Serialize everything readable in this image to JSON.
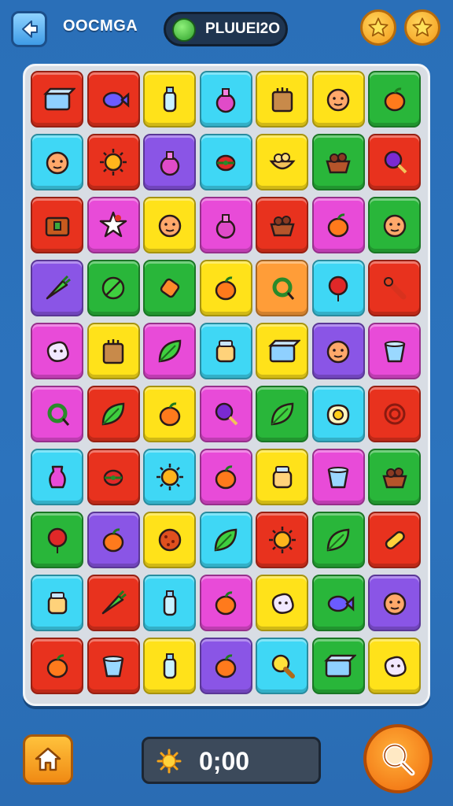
{
  "header": {
    "title": "OOCMGA",
    "level_label": "PLUUEI2O",
    "back_icon": "back-arrow-icon",
    "star_icons": [
      "star-icon",
      "star-icon"
    ]
  },
  "board": {
    "rows": 10,
    "cols": 7,
    "tiles": [
      [
        "red",
        "box"
      ],
      [
        "red",
        "fish"
      ],
      [
        "yellow",
        "bottle"
      ],
      [
        "cyan",
        "potion"
      ],
      [
        "yellow",
        "bag"
      ],
      [
        "yellow",
        "face"
      ],
      [
        "green",
        "fruit"
      ],
      [
        "cyan",
        "face"
      ],
      [
        "red",
        "sun"
      ],
      [
        "purple",
        "potion"
      ],
      [
        "cyan",
        "bug"
      ],
      [
        "yellow",
        "bowl"
      ],
      [
        "green",
        "basket"
      ],
      [
        "red",
        "lollipop"
      ],
      [
        "red",
        "chest"
      ],
      [
        "pink",
        "star"
      ],
      [
        "yellow",
        "face"
      ],
      [
        "pink",
        "potion"
      ],
      [
        "red",
        "basket"
      ],
      [
        "pink",
        "fruit"
      ],
      [
        "green",
        "face"
      ],
      [
        "purple",
        "carrot"
      ],
      [
        "green",
        "circle"
      ],
      [
        "green",
        "candy"
      ],
      [
        "yellow",
        "fruit"
      ],
      [
        "orange",
        "ring"
      ],
      [
        "cyan",
        "balloon"
      ],
      [
        "red",
        "pin"
      ],
      [
        "pink",
        "blob"
      ],
      [
        "yellow",
        "bag"
      ],
      [
        "pink",
        "leaf"
      ],
      [
        "cyan",
        "jar"
      ],
      [
        "yellow",
        "box"
      ],
      [
        "purple",
        "face"
      ],
      [
        "pink",
        "cup"
      ],
      [
        "pink",
        "ring"
      ],
      [
        "red",
        "leaf"
      ],
      [
        "yellow",
        "fruit"
      ],
      [
        "pink",
        "lollipop"
      ],
      [
        "green",
        "leaf"
      ],
      [
        "cyan",
        "egg"
      ],
      [
        "red",
        "swirl"
      ],
      [
        "cyan",
        "vase"
      ],
      [
        "red",
        "bug"
      ],
      [
        "cyan",
        "sun"
      ],
      [
        "pink",
        "fruit"
      ],
      [
        "yellow",
        "jar"
      ],
      [
        "pink",
        "cup"
      ],
      [
        "green",
        "basket"
      ],
      [
        "green",
        "balloon"
      ],
      [
        "purple",
        "fruit"
      ],
      [
        "yellow",
        "ball"
      ],
      [
        "cyan",
        "leaf"
      ],
      [
        "red",
        "sun"
      ],
      [
        "green",
        "leaf"
      ],
      [
        "red",
        "pill"
      ],
      [
        "cyan",
        "jar"
      ],
      [
        "red",
        "carrot"
      ],
      [
        "cyan",
        "bottle"
      ],
      [
        "pink",
        "fruit"
      ],
      [
        "yellow",
        "blob"
      ],
      [
        "green",
        "fish"
      ],
      [
        "purple",
        "face"
      ],
      [
        "red",
        "fruit"
      ],
      [
        "red",
        "cup"
      ],
      [
        "yellow",
        "bottle"
      ],
      [
        "purple",
        "fruit"
      ],
      [
        "cyan",
        "bulb"
      ],
      [
        "green",
        "box"
      ],
      [
        "yellow",
        "blob"
      ]
    ]
  },
  "colors": {
    "red": "#e8321e",
    "yellow": "#ffe21a",
    "green": "#29b63a",
    "cyan": "#3fd7f5",
    "pink": "#e84bd8",
    "purple": "#8a55e6",
    "orange": "#ff9d38"
  },
  "footer": {
    "home_icon": "home-icon",
    "timer_icon": "sun-icon",
    "timer_value": "0;00",
    "search_icon": "magnifier-icon"
  }
}
